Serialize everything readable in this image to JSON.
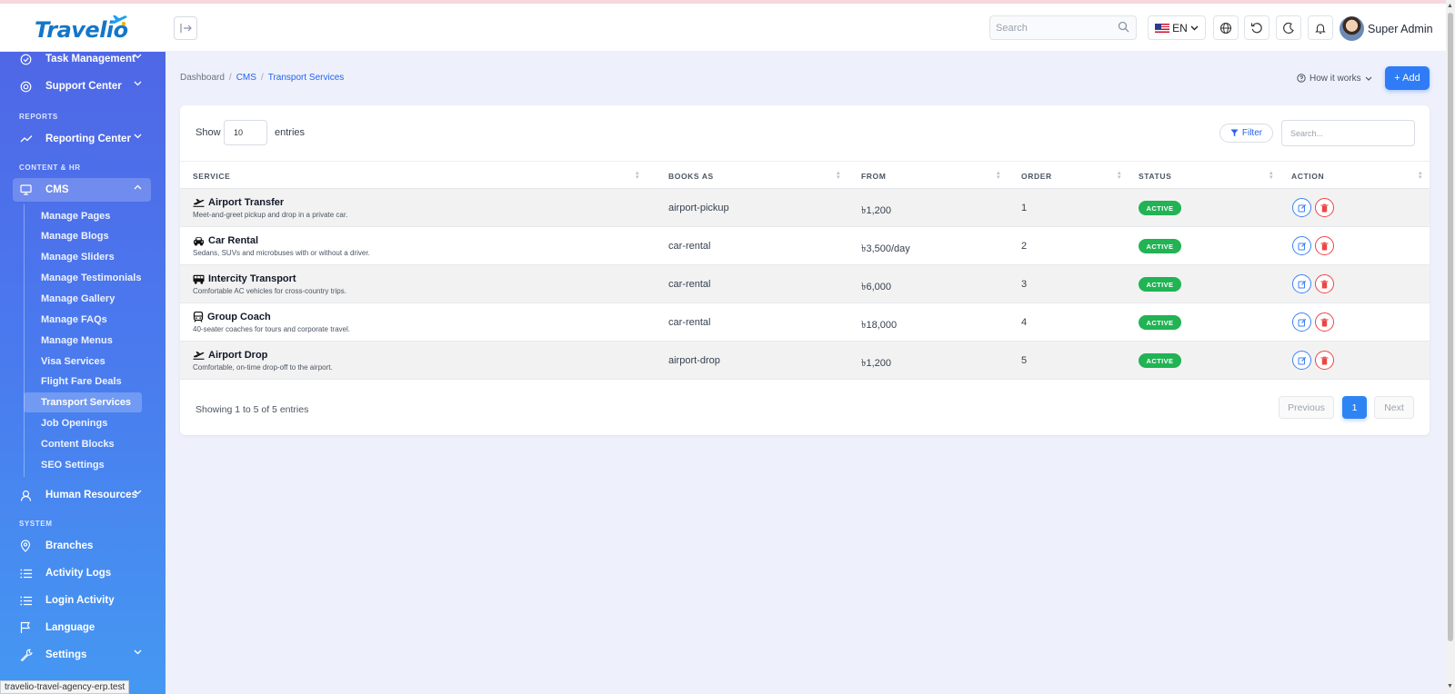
{
  "brand": {
    "name": "Travelio"
  },
  "header": {
    "search_placeholder": "Search",
    "language": "EN",
    "user_name": "Super Admin"
  },
  "sidebar": {
    "items_top": [
      {
        "label": "Task Management",
        "icon": "check-circle-icon"
      },
      {
        "label": "Support Center",
        "icon": "lifebuoy-icon"
      }
    ],
    "section_reports": "REPORTS",
    "reporting": {
      "label": "Reporting Center",
      "icon": "trend-icon"
    },
    "section_content": "CONTENT & HR",
    "cms": {
      "label": "CMS",
      "icon": "monitor-icon"
    },
    "cms_items": [
      "Manage Pages",
      "Manage Blogs",
      "Manage Sliders",
      "Manage Testimonials",
      "Manage Gallery",
      "Manage FAQs",
      "Manage Menus",
      "Visa Services",
      "Flight Fare Deals",
      "Transport Services",
      "Job Openings",
      "Content Blocks",
      "SEO Settings"
    ],
    "hr": {
      "label": "Human Resources",
      "icon": "user-icon"
    },
    "section_system": "SYSTEM",
    "system_items": [
      {
        "label": "Branches",
        "icon": "map-pin-icon"
      },
      {
        "label": "Activity Logs",
        "icon": "list-icon"
      },
      {
        "label": "Login Activity",
        "icon": "list-icon"
      },
      {
        "label": "Language",
        "icon": "flag-icon"
      },
      {
        "label": "Settings",
        "icon": "wrench-icon"
      }
    ]
  },
  "breadcrumb": {
    "home": "Dashboard",
    "parent": "CMS",
    "current": "Transport Services"
  },
  "toolbar": {
    "how_it_works": "How it works",
    "add_label": "+ Add"
  },
  "table_controls": {
    "show_label": "Show",
    "entries_value": "10",
    "entries_label": "entries",
    "filter_label": "Filter",
    "search_placeholder": "Search..."
  },
  "table": {
    "columns": [
      "SERVICE",
      "BOOKS AS",
      "FROM",
      "ORDER",
      "STATUS",
      "ACTION"
    ],
    "rows": [
      {
        "icon": "plane-departure-icon",
        "title": "Airport Transfer",
        "desc": "Meet-and-greet pickup and drop in a private car.",
        "books_as": "airport-pickup",
        "from": "৳1,200",
        "order": "1",
        "status": "ACTIVE"
      },
      {
        "icon": "car-icon",
        "title": "Car Rental",
        "desc": "Sedans, SUVs and microbuses with or without a driver.",
        "books_as": "car-rental",
        "from": "৳3,500/day",
        "order": "2",
        "status": "ACTIVE"
      },
      {
        "icon": "bus-icon",
        "title": "Intercity Transport",
        "desc": "Comfortable AC vehicles for cross-country trips.",
        "books_as": "car-rental",
        "from": "৳6,000",
        "order": "3",
        "status": "ACTIVE"
      },
      {
        "icon": "coach-icon",
        "title": "Group Coach",
        "desc": "40-seater coaches for tours and corporate travel.",
        "books_as": "car-rental",
        "from": "৳18,000",
        "order": "4",
        "status": "ACTIVE"
      },
      {
        "icon": "plane-departure-icon",
        "title": "Airport Drop",
        "desc": "Comfortable, on-time drop-off to the airport.",
        "books_as": "airport-drop",
        "from": "৳1,200",
        "order": "5",
        "status": "ACTIVE"
      }
    ]
  },
  "pagination": {
    "summary": "Showing 1 to 5 of 5 entries",
    "previous": "Previous",
    "current": "1",
    "next": "Next"
  },
  "status_bar_url": "travelio-travel-agency-erp.test",
  "colors": {
    "accent": "#2f7cf6",
    "active_badge": "#21b354",
    "delete": "#ef4444",
    "sidebar_top": "#4f67e6",
    "sidebar_bottom": "#4598f2"
  }
}
